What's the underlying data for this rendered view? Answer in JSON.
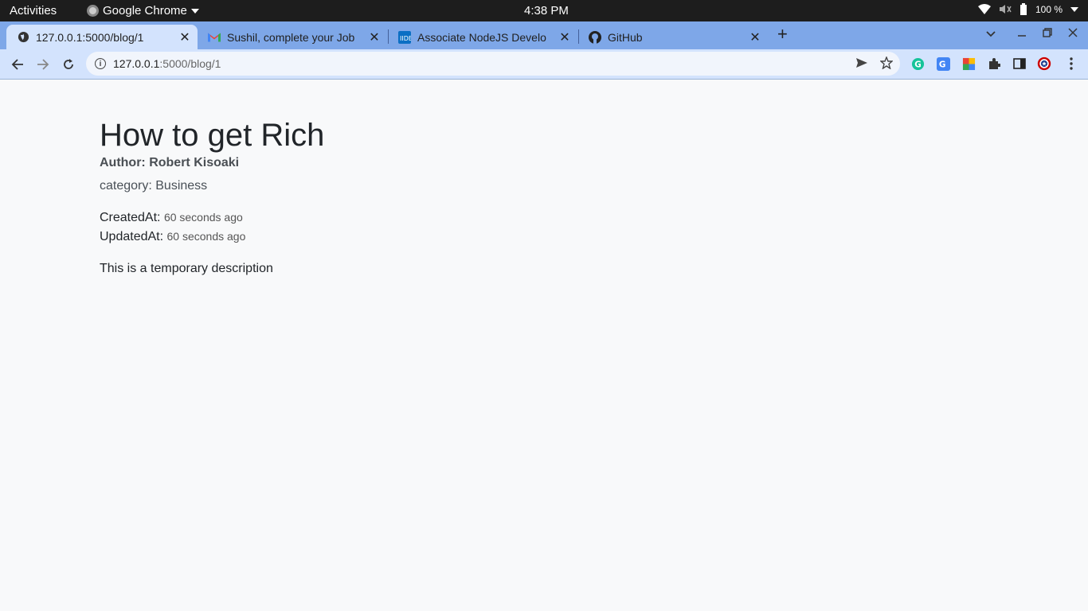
{
  "system_bar": {
    "activities": "Activities",
    "app_name": "Google Chrome",
    "clock": "4:38 PM",
    "battery": "100 %"
  },
  "tabs": [
    {
      "title": "127.0.0.1:5000/blog/1",
      "icon": "globe-icon",
      "active": true
    },
    {
      "title": "Sushil, complete your Job",
      "icon": "gmail-icon",
      "active": false
    },
    {
      "title": "Associate NodeJS Develo",
      "icon": "iide-icon",
      "active": false
    },
    {
      "title": "GitHub",
      "icon": "github-icon",
      "active": false
    }
  ],
  "address_bar": {
    "host": "127.0.0.1",
    "path": ":5000/blog/1"
  },
  "post": {
    "title": "How to get Rich",
    "author": "Author: Robert Kisoaki",
    "category": "category: Business",
    "created_label": "CreatedAt:",
    "created_value": "60 seconds ago",
    "updated_label": "UpdatedAt:",
    "updated_value": "60 seconds ago",
    "description": "This is a temporary description"
  },
  "colors": {
    "tabstrip": "#7ea7e8",
    "active_tab": "#d3e3fd",
    "page_bg": "#f8f9fa"
  }
}
